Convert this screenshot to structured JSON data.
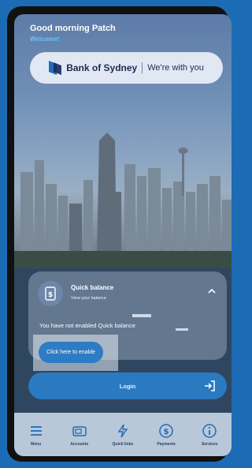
{
  "header": {
    "greeting": "Good morning Patch",
    "welcome": "Welcome!"
  },
  "brand": {
    "name": "Bank of Sydney",
    "tagline": "We're with you"
  },
  "quick_balance": {
    "title": "Quick balance",
    "subtitle": "View your balance",
    "message": "You have not enabled Quick balance",
    "enable_button": "Click here to enable"
  },
  "login": {
    "label": "Login"
  },
  "tabbar": {
    "items": [
      {
        "label": "Menu",
        "icon": "menu-icon"
      },
      {
        "label": "Accounts",
        "icon": "accounts-icon"
      },
      {
        "label": "Quick links",
        "icon": "quick-links-icon"
      },
      {
        "label": "Payments",
        "icon": "payments-icon"
      },
      {
        "label": "Services",
        "icon": "services-icon"
      }
    ]
  },
  "colors": {
    "accent": "#2a7ac1",
    "welcome": "#66c6ff",
    "frame": "#1c6bb5",
    "brand_text": "#1e2a55"
  }
}
